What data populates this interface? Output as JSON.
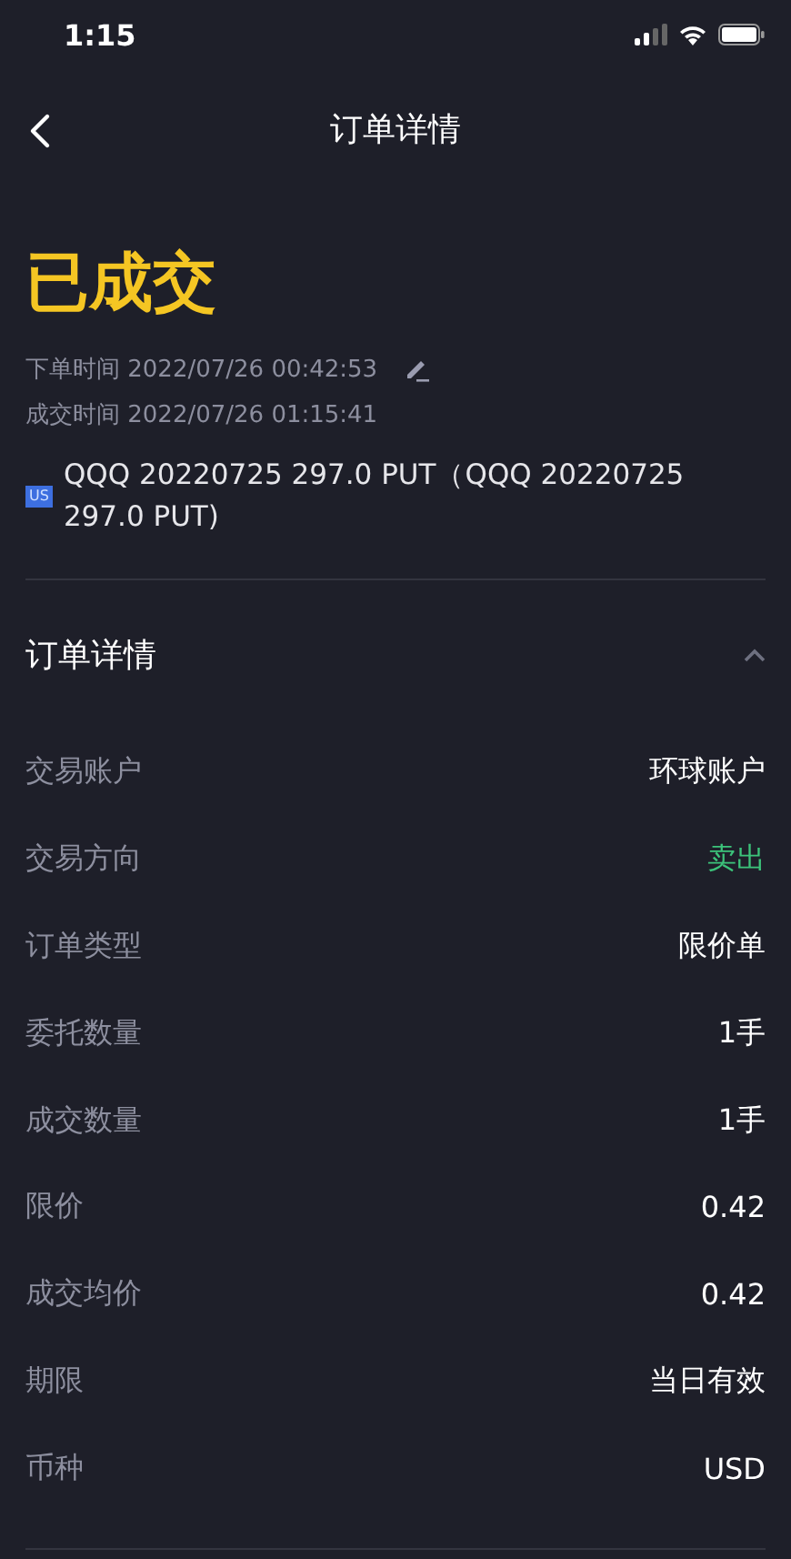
{
  "status_bar": {
    "time": "1:15"
  },
  "nav": {
    "title": "订单详情"
  },
  "order": {
    "status": "已成交",
    "placed": "下单时间 2022/07/26 00:42:53",
    "filled": "成交时间 2022/07/26 01:15:41",
    "market": "US",
    "instrument": "QQQ 20220725 297.0 PUT（QQQ 20220725 297.0 PUT)"
  },
  "section": {
    "title": "订单详情",
    "expanded": true,
    "rows": [
      {
        "label": "交易账户",
        "value": "环球账户",
        "kind": "plain"
      },
      {
        "label": "交易方向",
        "value": "卖出",
        "kind": "sell"
      },
      {
        "label": "订单类型",
        "value": "限价单",
        "kind": "plain"
      },
      {
        "label": "委托数量",
        "value": "1手",
        "kind": "plain"
      },
      {
        "label": "成交数量",
        "value": "1手",
        "kind": "plain"
      },
      {
        "label": "限价",
        "value": "0.42",
        "kind": "plain"
      },
      {
        "label": "成交均价",
        "value": "0.42",
        "kind": "plain"
      },
      {
        "label": "期限",
        "value": "当日有效",
        "kind": "plain"
      },
      {
        "label": "币种",
        "value": "USD",
        "kind": "plain"
      }
    ]
  }
}
